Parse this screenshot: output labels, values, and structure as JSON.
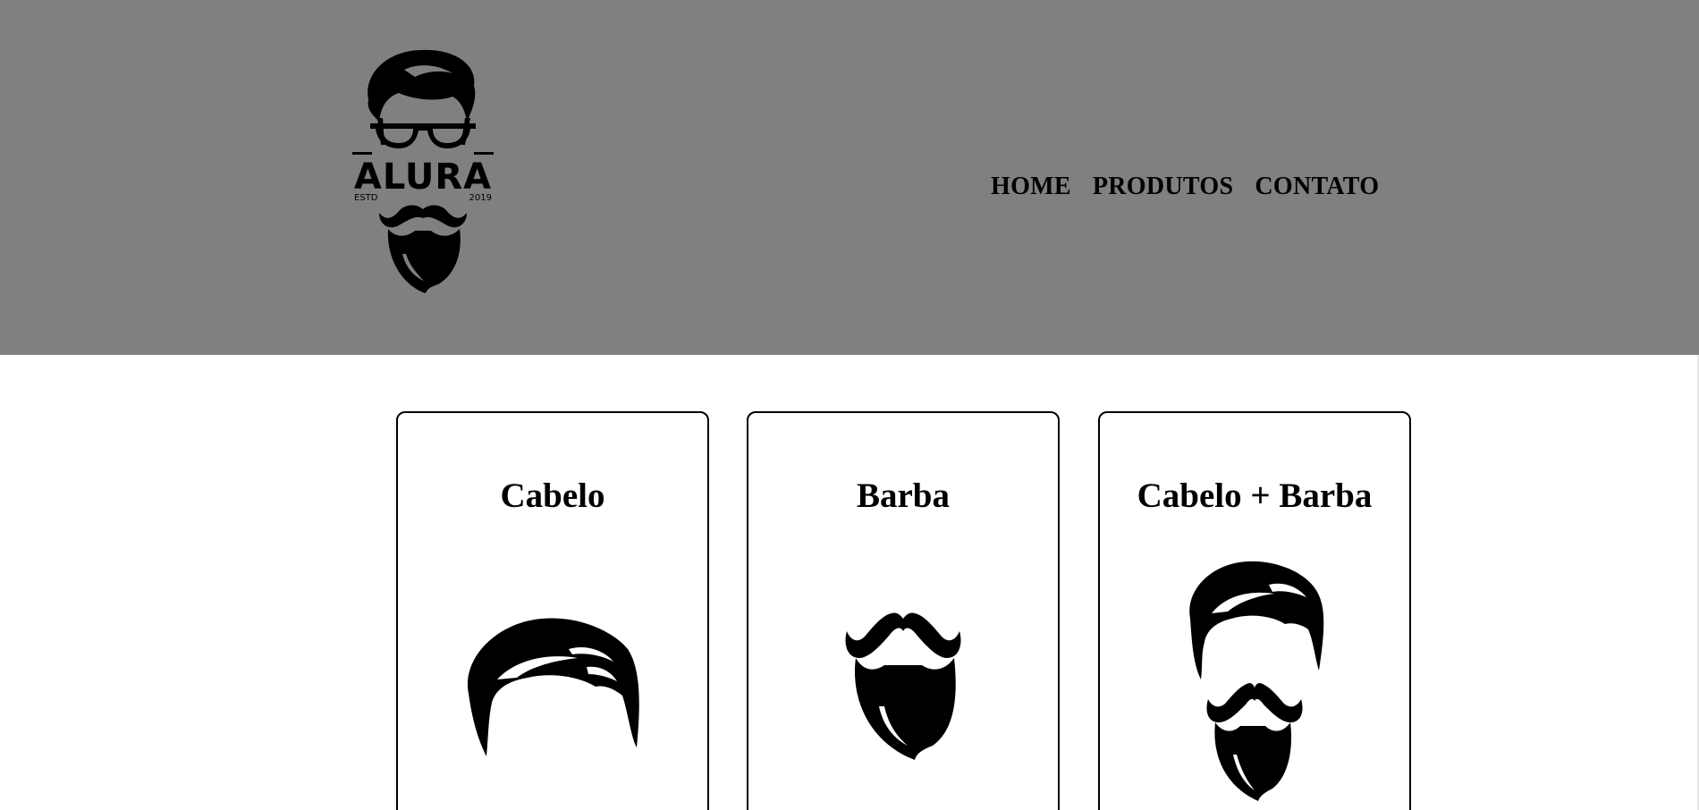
{
  "header": {
    "logo": {
      "brand_text": "ALURA",
      "estd_text": "ESTD",
      "year_text": "2019",
      "icon": "bearded-man-glasses-logo"
    },
    "nav": [
      {
        "label": "HOME"
      },
      {
        "label": "PRODUTOS"
      },
      {
        "label": "CONTATO"
      }
    ],
    "background_color": "#808080"
  },
  "products": [
    {
      "title": "Cabelo",
      "icon": "hair-icon"
    },
    {
      "title": "Barba",
      "icon": "beard-icon"
    },
    {
      "title": "Cabelo + Barba",
      "icon": "hair-and-beard-icon"
    }
  ]
}
